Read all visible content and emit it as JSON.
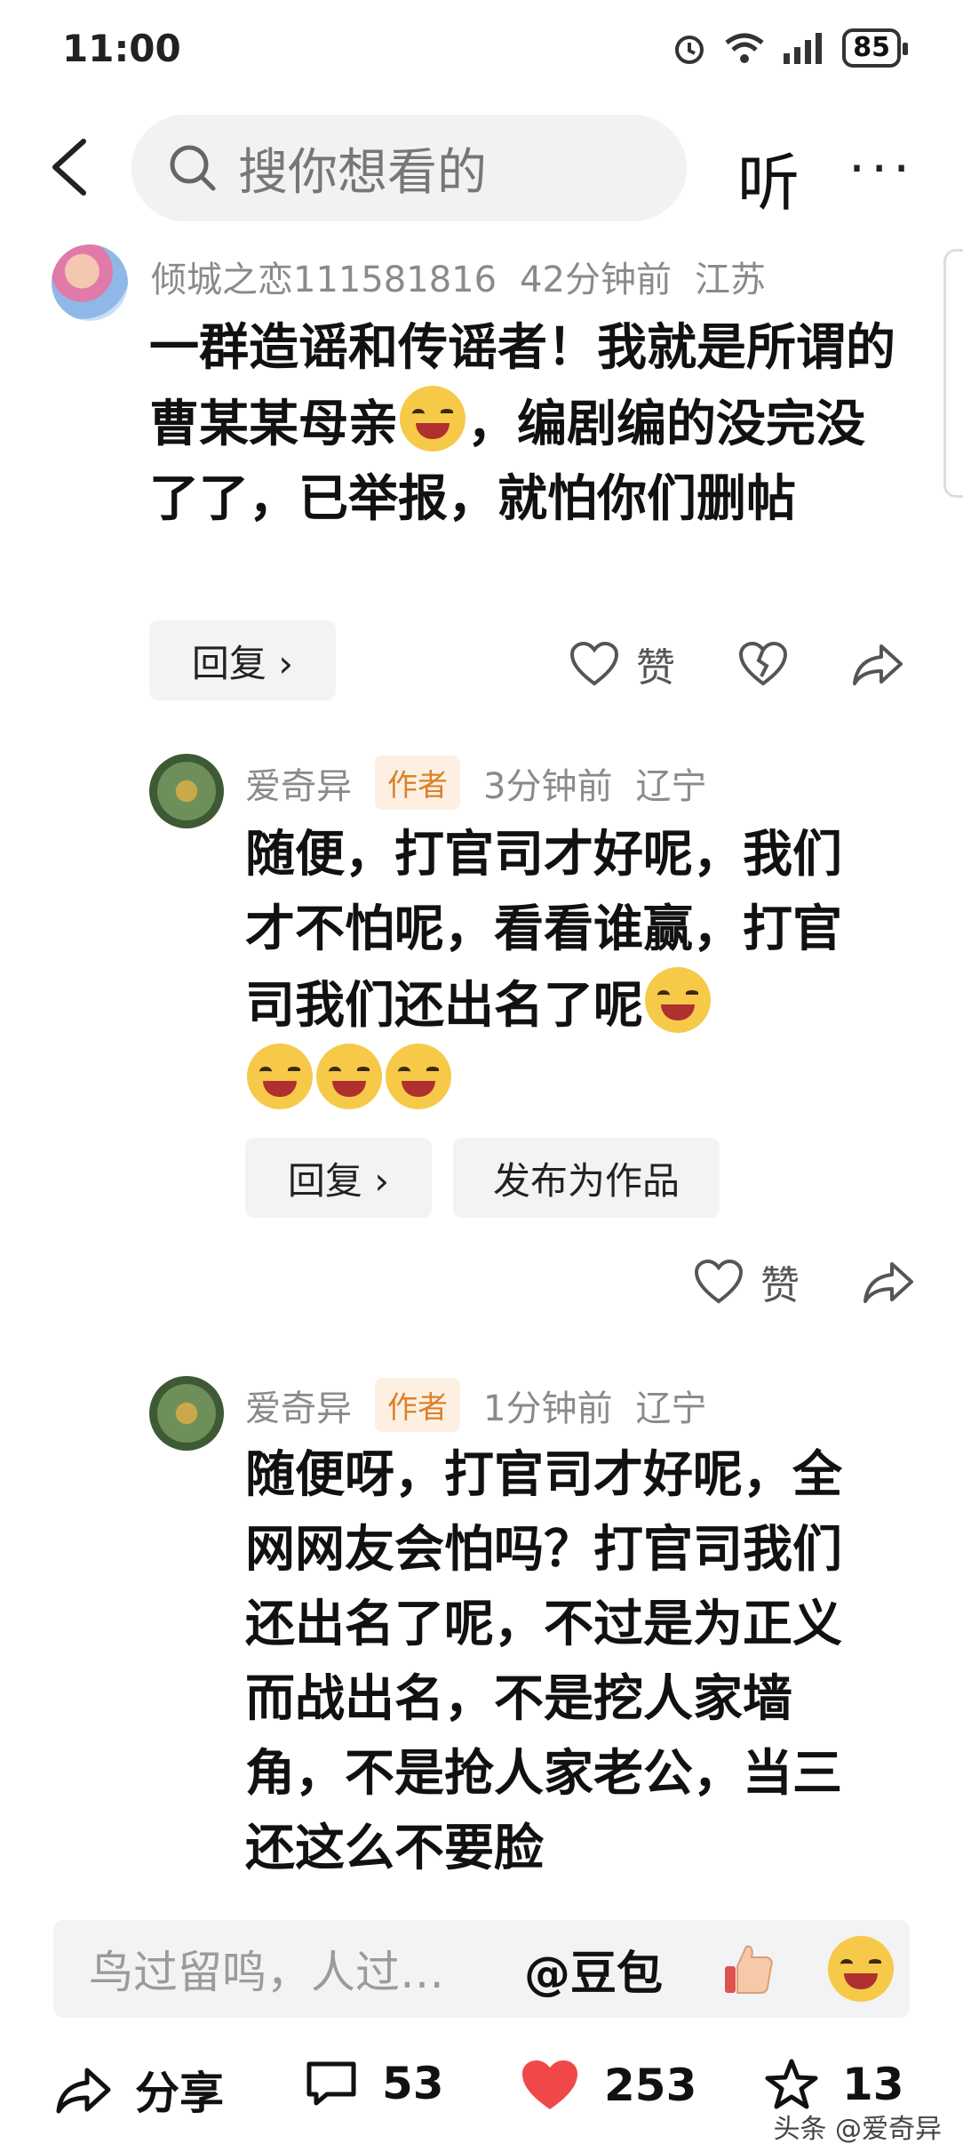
{
  "status": {
    "time": "11:00",
    "battery": "85"
  },
  "search": {
    "placeholder": "搜你想看的",
    "listen": "听",
    "more": "···"
  },
  "comments": [
    {
      "user": "倾城之恋111581816",
      "time": "42分钟前",
      "location": "江苏",
      "text_parts": [
        "一群造谣和传谣者！我就是所谓的曹某某母亲",
        "，编剧编的没完没了了，已举报，就怕你们删帖"
      ],
      "reply_label": "回复 ›",
      "like_label": "赞"
    },
    {
      "user": "爱奇异",
      "badge": "作者",
      "time": "3分钟前",
      "location": "辽宁",
      "text": "随便，打官司才好呢，我们才不怕呢，看看谁赢，打官司我们还出名了呢",
      "reply_label": "回复 ›",
      "publish_label": "发布为作品",
      "like_label": "赞"
    },
    {
      "user": "爱奇异",
      "badge": "作者",
      "time": "1分钟前",
      "location": "辽宁",
      "text": "随便呀，打官司才好呢，全网网友会怕吗？打官司我们还出名了呢，不过是为正义而战出名，不是挖人家墙角，不是抢人家老公，当三还这么不要脸"
    }
  ],
  "input": {
    "placeholder": "鸟过留鸣，人过…",
    "doubao": "@豆包"
  },
  "bottom": {
    "share": "分享",
    "comments": "53",
    "likes": "253",
    "favorites": "13"
  },
  "watermark": "头条 @爱奇异",
  "colors": {
    "like_red": "#f04848",
    "badge_bg": "#fdf0e2",
    "badge_text": "#d9822b"
  }
}
